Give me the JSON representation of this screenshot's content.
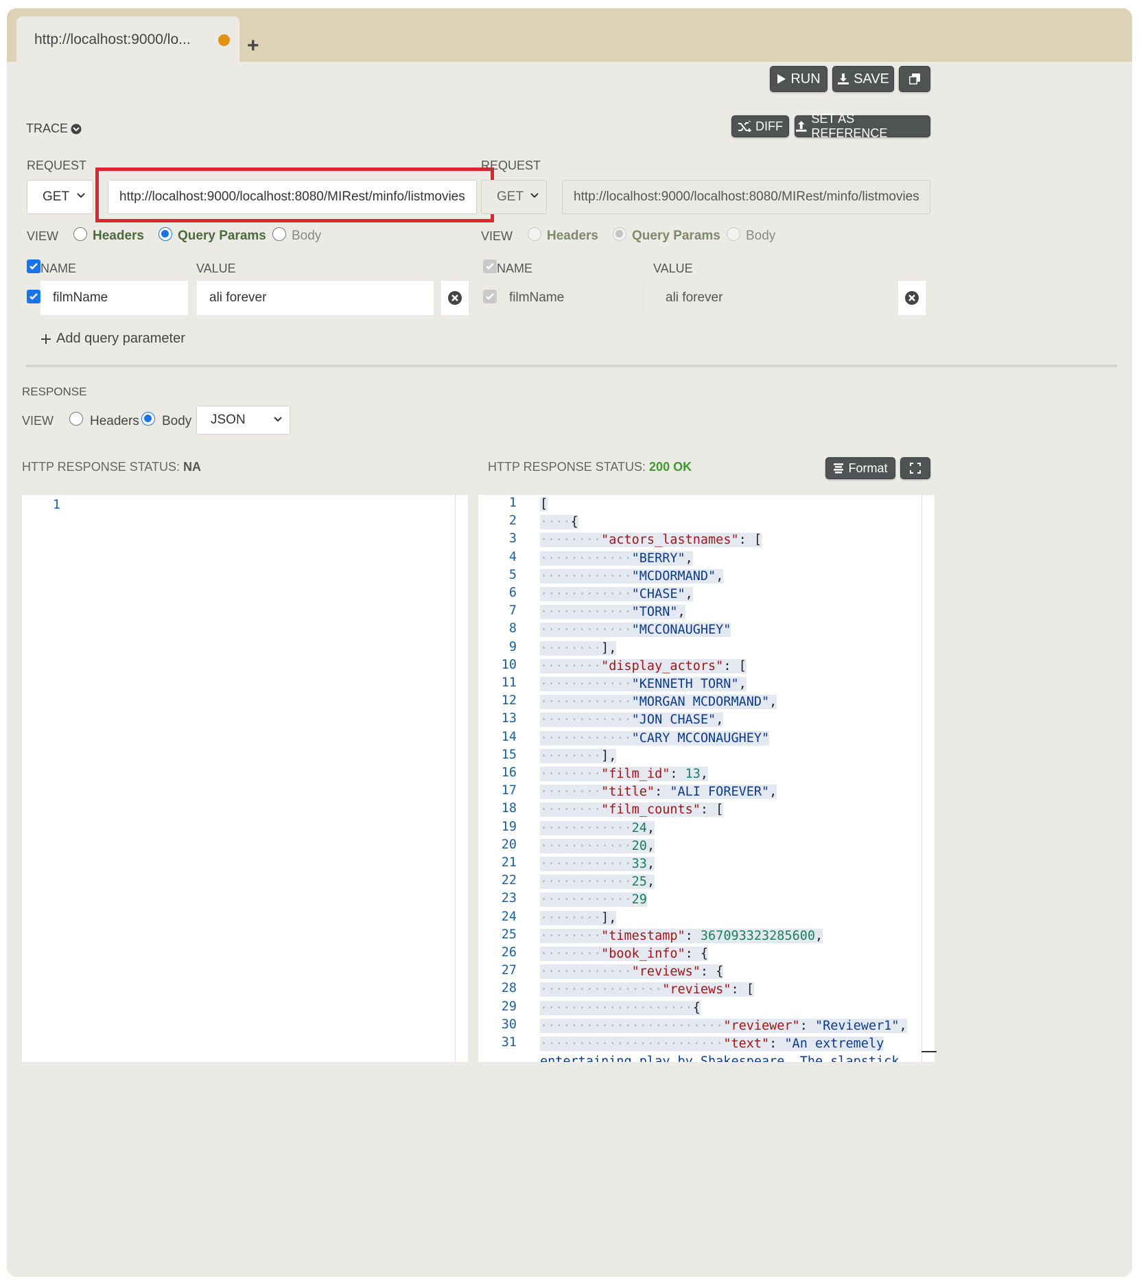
{
  "tab": {
    "title": "http://localhost:9000/lo...",
    "new_tab_icon": "plus-icon"
  },
  "toolbar": {
    "run_label": "RUN",
    "save_label": "SAVE",
    "diff_label": "DIFF",
    "set_ref_label": "SET AS REFERENCE"
  },
  "trace_label": "TRACE",
  "left": {
    "request_label": "REQUEST",
    "method": "GET",
    "url": "http://localhost:9000/localhost:8080/MIRest/minfo/listmovies",
    "view_label": "VIEW",
    "view_options": [
      "Headers",
      "Query Params",
      "Body"
    ],
    "name_header": "NAME",
    "value_header": "VALUE",
    "param_name": "filmName",
    "param_value": "ali forever",
    "add_param_label": "Add query parameter"
  },
  "right": {
    "request_label": "REQUEST",
    "method": "GET",
    "url": "http://localhost:9000/localhost:8080/MIRest/minfo/listmovies",
    "view_label": "VIEW",
    "view_options": [
      "Headers",
      "Query Params",
      "Body"
    ],
    "name_header": "NAME",
    "value_header": "VALUE",
    "param_name": "filmName",
    "param_value": "ali forever"
  },
  "response": {
    "label": "RESPONSE",
    "view_label": "VIEW",
    "headers_label": "Headers",
    "body_label": "Body",
    "format_select": "JSON",
    "left_status_label": "HTTP RESPONSE STATUS: ",
    "left_status_value": "NA",
    "right_status_label": "HTTP RESPONSE STATUS: ",
    "right_status_value": "200 OK",
    "format_button": "Format"
  },
  "left_editor": {
    "lines": [
      "1"
    ]
  },
  "right_editor": {
    "line_numbers": [
      "1",
      "2",
      "3",
      "4",
      "5",
      "6",
      "7",
      "8",
      "9",
      "10",
      "11",
      "12",
      "13",
      "14",
      "15",
      "16",
      "17",
      "18",
      "19",
      "20",
      "21",
      "22",
      "23",
      "24",
      "25",
      "26",
      "27",
      "28",
      "29",
      "30",
      "31"
    ],
    "last_partial_line": "entertaining play by Shakespeare. The slapstick"
  },
  "colors": {
    "accent_blue": "#1a73e8",
    "highlight_red": "#e0232e",
    "ok_green": "#3c9a2e",
    "tab_dot": "#e39212"
  }
}
